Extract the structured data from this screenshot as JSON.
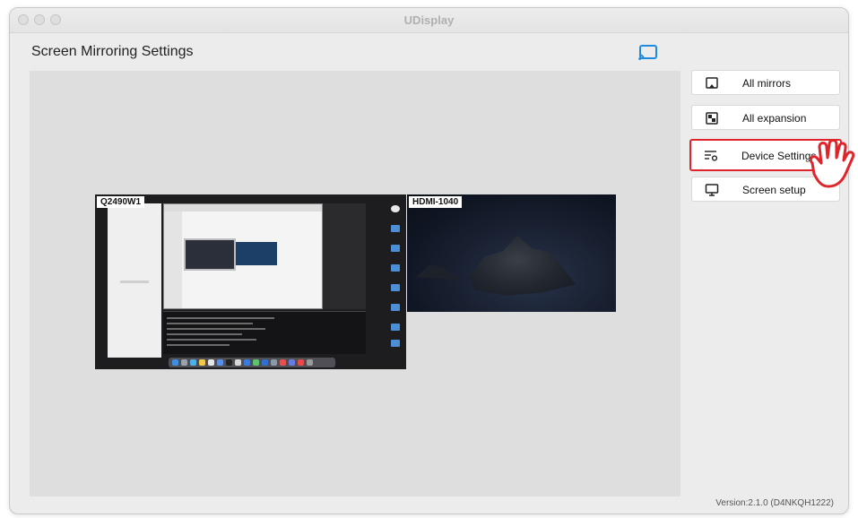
{
  "window": {
    "title": "UDisplay"
  },
  "page": {
    "title": "Screen Mirroring Settings"
  },
  "monitors": [
    {
      "label": "Q2490W1"
    },
    {
      "label": "HDMI-1040"
    }
  ],
  "side_buttons": [
    {
      "label": "All mirrors",
      "icon": "mirror-icon",
      "highlighted": false
    },
    {
      "label": "All expansion",
      "icon": "expansion-icon",
      "highlighted": false
    },
    {
      "label": "Device Settings",
      "icon": "settings-list-icon",
      "highlighted": true
    },
    {
      "label": "Screen setup",
      "icon": "monitor-icon",
      "highlighted": false
    }
  ],
  "version": "Version:2.1.0 (D4NKQH1222)",
  "colors": {
    "accent_blue": "#1e8ae0",
    "highlight_red": "#e0242b"
  }
}
